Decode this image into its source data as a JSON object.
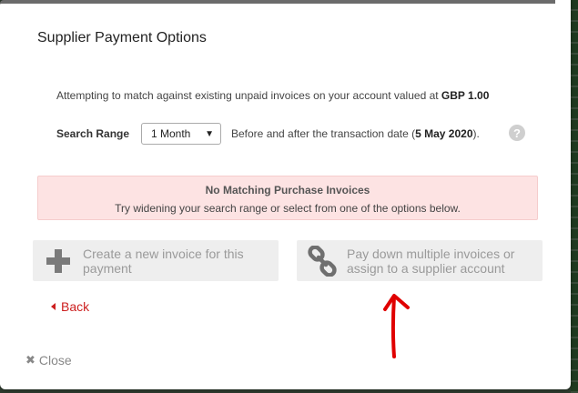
{
  "dialog": {
    "title": "Supplier Payment Options",
    "intro_text": "Attempting to match against existing unpaid invoices on your account valued at ",
    "intro_amount": "GBP 1.00",
    "search": {
      "label": "Search Range",
      "selected": "1 Month",
      "range_prefix": "Before and after the transaction date (",
      "range_date": "5 May 2020",
      "range_suffix": ")."
    },
    "help_glyph": "?",
    "alert": {
      "title": "No Matching Purchase Invoices",
      "body": "Try widening your search range or select from one of the options below."
    },
    "options": [
      {
        "label": "Create a new invoice for this payment",
        "icon": "plus-icon"
      },
      {
        "label": "Pay down multiple invoices or assign to a supplier account",
        "icon": "link-icon"
      }
    ],
    "back_label": "Back",
    "close_label": "Close",
    "close_glyph": "✖"
  },
  "colors": {
    "alert_bg": "#fde3e3",
    "option_bg": "#eeeeee",
    "link_red": "#cc1f1f",
    "annotation_arrow": "#e00000"
  }
}
